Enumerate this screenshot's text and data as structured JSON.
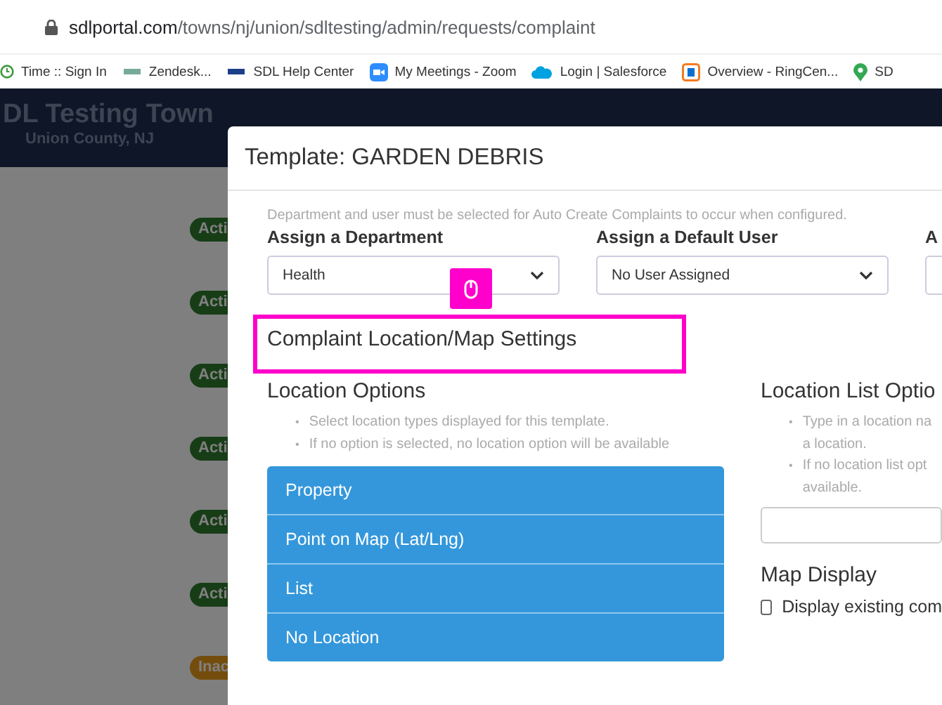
{
  "browser": {
    "url_host": "sdlportal.com",
    "url_path": "/towns/nj/union/sdltesting/admin/requests/complaint",
    "bookmarks": [
      {
        "label": "Time :: Sign In",
        "kind": "clock"
      },
      {
        "label": "Zendesk...",
        "kind": "sdlgreen"
      },
      {
        "label": "SDL Help Center",
        "kind": "sdl"
      },
      {
        "label": "My Meetings - Zoom",
        "kind": "zoom"
      },
      {
        "label": "Login | Salesforce",
        "kind": "cloud"
      },
      {
        "label": "Overview - RingCen...",
        "kind": "ring"
      },
      {
        "label": "SD",
        "kind": "pin"
      }
    ]
  },
  "site": {
    "title": "DL Testing Town",
    "subtitle": "Union County, NJ"
  },
  "status_badges": [
    {
      "label": "Acti",
      "kind": "active"
    },
    {
      "label": "Acti",
      "kind": "active"
    },
    {
      "label": "Acti",
      "kind": "active"
    },
    {
      "label": "Acti",
      "kind": "active"
    },
    {
      "label": "Acti",
      "kind": "active"
    },
    {
      "label": "Acti",
      "kind": "active"
    },
    {
      "label": "Inac",
      "kind": "inactive"
    }
  ],
  "modal": {
    "title": "Template: GARDEN DEBRIS",
    "note": "Department and user must be selected for Auto Create Complaints to occur when configured.",
    "selects": [
      {
        "label": "Assign a Department",
        "value": "Health"
      },
      {
        "label": "Assign a Default User",
        "value": "No User Assigned"
      },
      {
        "label": "A"
      }
    ],
    "section_heading": "Complaint Location/Map Settings",
    "location_options": {
      "heading": "Location Options",
      "bullet": "•",
      "hints": [
        "Select location types displayed for this template.",
        "If no option is selected, no location option will be available"
      ],
      "items": [
        "Property",
        "Point on Map (Lat/Lng)",
        "List",
        "No Location"
      ]
    },
    "location_list": {
      "heading": "Location List Optio",
      "bullet": "•",
      "hints": [
        [
          "Type in a location na",
          "a location."
        ],
        [
          "If no location list opt",
          "available."
        ]
      ]
    },
    "map_display": {
      "heading": "Map Display",
      "checkbox": {
        "label": "Display existing com",
        "checked": false
      }
    }
  }
}
